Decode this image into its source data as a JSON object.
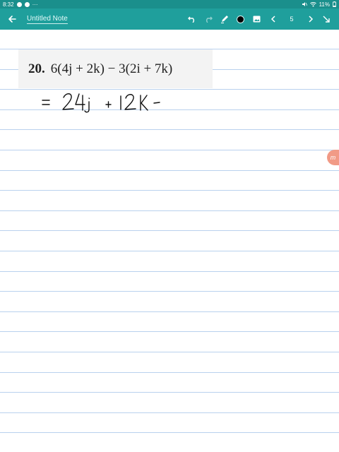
{
  "status_bar": {
    "time": "8:32",
    "battery": "11%",
    "notification_icons": [
      "chat-icon",
      "chat-icon",
      "more-icon"
    ],
    "system_icons": [
      "mute-icon",
      "wifi-icon",
      "battery-icon"
    ]
  },
  "toolbar": {
    "back_icon": "arrow-left-icon",
    "title": "Untitled Note",
    "tools": [
      "undo-icon",
      "redo-icon",
      "pen-icon",
      "color-swatch",
      "image-icon",
      "prev-page-icon",
      "page-number",
      "next-page-icon",
      "collapse-icon"
    ],
    "pen_color": "#000000",
    "page_number": "5"
  },
  "problem": {
    "number": "20.",
    "expression": "6(4j + 2k) − 3(2i + 7k)"
  },
  "handwriting": {
    "text": "= 24j + 12K −",
    "color": "#111111"
  },
  "side_tab": {
    "label": "m",
    "color": "#f19a86"
  },
  "colors": {
    "toolbar_bg": "#1f9f9c",
    "status_bg": "#1a8f8c",
    "rule_line": "#b9d1ee"
  }
}
